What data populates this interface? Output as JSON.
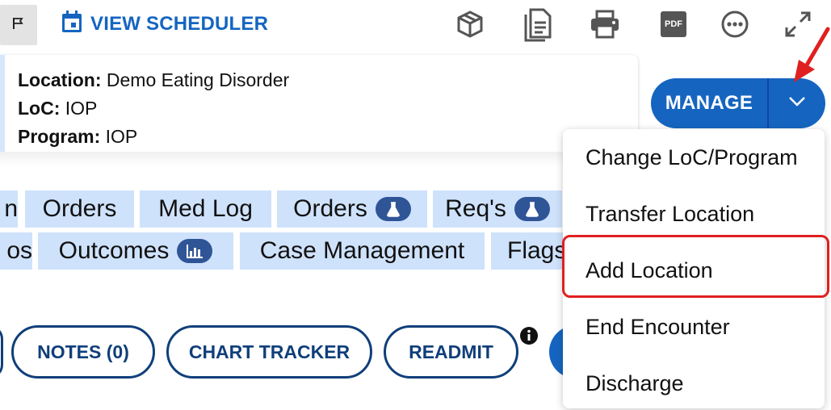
{
  "header": {
    "flag_icon": "flag-icon",
    "scheduler_icon": "calendar-icon",
    "scheduler_label": "VIEW SCHEDULER",
    "toolbar_icons": [
      "package-icon",
      "document-icon",
      "printer-icon",
      "pdf-icon",
      "more-icon",
      "expand-icon"
    ],
    "pdf_label": "PDF"
  },
  "info": {
    "location_label": "Location:",
    "location_value": "Demo Eating Disorder",
    "loc_label": "LoC:",
    "loc_value": "IOP",
    "program_label": "Program:",
    "program_value": "IOP"
  },
  "manage": {
    "label": "MANAGE",
    "caret_icon": "chevron-down-icon",
    "accent": "#1565c0"
  },
  "tabs_row1": [
    {
      "label": "n"
    },
    {
      "label": "Orders"
    },
    {
      "label": "Med Log"
    },
    {
      "label": "Orders",
      "badge": "flask-icon"
    },
    {
      "label": "Req's",
      "badge": "flask-icon"
    }
  ],
  "tabs_row2": [
    {
      "label": "os"
    },
    {
      "label": "Outcomes",
      "badge": "bar-chart-icon"
    },
    {
      "label": "Case Management"
    },
    {
      "label": "Flags"
    }
  ],
  "actions": {
    "notes_label": "NOTES (0)",
    "chart_tracker_label": "CHART TRACKER",
    "readmit_label": "READMIT",
    "info_icon": "info-icon"
  },
  "dropdown": {
    "items": [
      "Change LoC/Program",
      "Transfer Location",
      "Add Location",
      "End Encounter",
      "Discharge"
    ],
    "highlighted": "Add Location"
  },
  "annotations": {
    "arrow_color": "#e02020",
    "highlight_color": "#e02020"
  }
}
